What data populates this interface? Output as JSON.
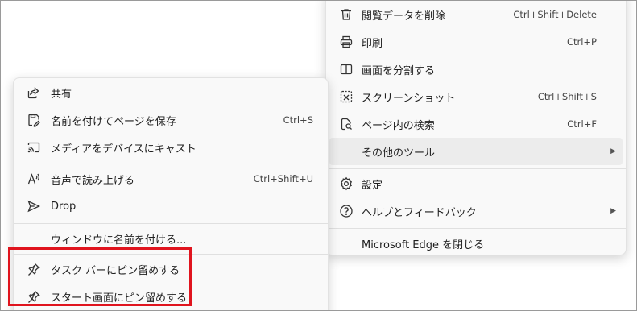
{
  "main_menu": {
    "items": [
      {
        "label": "閲覧データを削除",
        "shortcut": "Ctrl+Shift+Delete",
        "icon": "trash-icon"
      },
      {
        "label": "印刷",
        "shortcut": "Ctrl+P",
        "icon": "printer-icon"
      },
      {
        "label": "画面を分割する",
        "shortcut": "",
        "icon": "split-screen-icon"
      },
      {
        "label": "スクリーンショット",
        "shortcut": "Ctrl+Shift+S",
        "icon": "screenshot-icon"
      },
      {
        "label": "ページ内の検索",
        "shortcut": "Ctrl+F",
        "icon": "find-in-page-icon"
      },
      {
        "label": "その他のツール",
        "shortcut": "",
        "icon": "",
        "submenu": true
      },
      {
        "label": "設定",
        "shortcut": "",
        "icon": "gear-icon"
      },
      {
        "label": "ヘルプとフィードバック",
        "shortcut": "",
        "icon": "help-icon",
        "submenu": true
      },
      {
        "label": "Microsoft Edge を閉じる",
        "shortcut": "",
        "icon": ""
      }
    ],
    "arrow": "▶"
  },
  "sub_menu": {
    "items": [
      {
        "label": "共有",
        "shortcut": "",
        "icon": "share-icon"
      },
      {
        "label": "名前を付けてページを保存",
        "shortcut": "Ctrl+S",
        "icon": "save-icon"
      },
      {
        "label": "メディアをデバイスにキャスト",
        "shortcut": "",
        "icon": "cast-icon"
      },
      {
        "label": "音声で読み上げる",
        "shortcut": "Ctrl+Shift+U",
        "icon": "read-aloud-icon"
      },
      {
        "label": "Drop",
        "shortcut": "",
        "icon": "send-icon"
      },
      {
        "label": "ウィンドウに名前を付ける...",
        "shortcut": "",
        "icon": ""
      },
      {
        "label": "タスク バーにピン留めする",
        "shortcut": "",
        "icon": "pin-icon"
      },
      {
        "label": "スタート画面にピン留めする",
        "shortcut": "",
        "icon": "pin-icon"
      }
    ]
  },
  "colors": {
    "highlight_border": "#e0141e",
    "menu_background": "#f9f9f9",
    "hover_background": "#ececec"
  }
}
